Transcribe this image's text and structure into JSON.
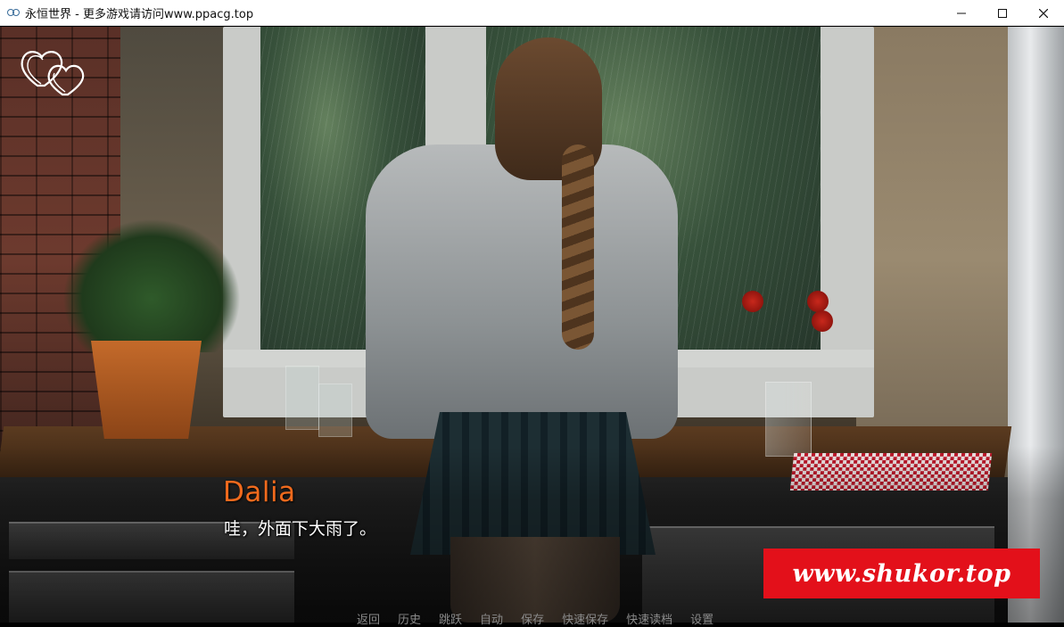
{
  "window": {
    "title": "永恒世界 - 更多游戏请访问www.ppacg.top",
    "icon": "infinity-icon",
    "controls": [
      "minimize-icon",
      "maximize-icon",
      "close-icon"
    ]
  },
  "game": {
    "affection_icon": "double-heart-icon",
    "speaker": "Dalia",
    "speaker_color": "#f06a1d",
    "dialogue": "哇，外面下大雨了。",
    "quick_menu": {
      "back": "返回",
      "history": "历史",
      "skip": "跳跃",
      "auto": "自动",
      "save": "保存",
      "quick_save": "快速保存",
      "quick_load": "快速读档",
      "settings": "设置"
    }
  },
  "watermark": {
    "text": "www.shukor.top",
    "background": "#e3101a"
  }
}
